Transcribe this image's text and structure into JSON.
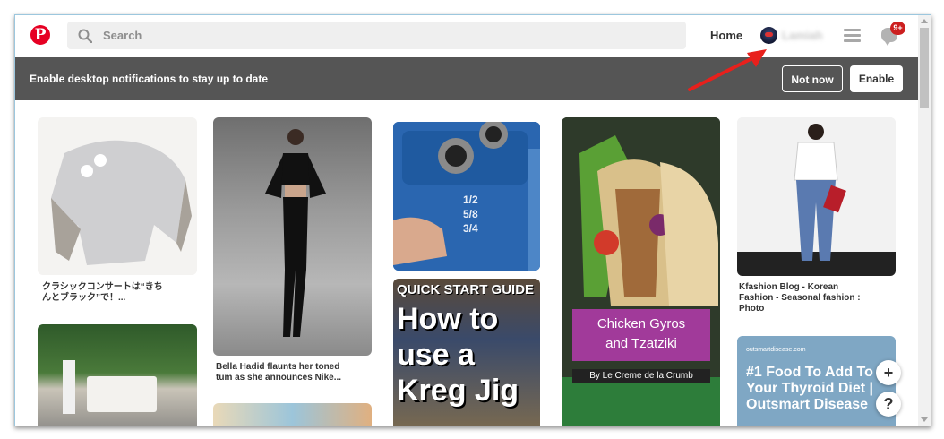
{
  "topbar": {
    "search_placeholder": "Search",
    "home_label": "Home",
    "username": "Lamiah",
    "notification_count": "9+"
  },
  "banner": {
    "message": "Enable desktop notifications to stay up to date",
    "not_now_label": "Not now",
    "enable_label": "Enable"
  },
  "pins": {
    "sweater_caption_1": "クラシックコンサートは“きち",
    "sweater_caption_2": "んとブラック”で！...",
    "bella_caption_1": "Bella Hadid flaunts her toned",
    "bella_caption_2": "tum as she announces Nike...",
    "kreg_marks": [
      "1/2",
      "5/8",
      "3/4"
    ],
    "kreg_heading": "QUICK START GUIDE",
    "kreg_title_lines": [
      "How to",
      "use a",
      "Kreg Jig"
    ],
    "gyros_title_1": "Chicken Gyros",
    "gyros_title_2": "and Tzatziki",
    "gyros_byline": "By Le Creme de la Crumb",
    "kfashion_caption_1": "Kfashion Blog - Korean",
    "kfashion_caption_2": "Fashion - Seasonal fashion :",
    "kfashion_caption_3": "Photo",
    "thyroid_site": "outsmartdisease.com",
    "thyroid_title": "#1 Food To Add To Your Thyroid Diet | Outsmart Disease"
  },
  "fab": {
    "add": "+",
    "help": "?"
  },
  "colors": {
    "brand": "#e60023",
    "banner_bg": "#555555",
    "annotation_arrow": "#e8201c"
  }
}
